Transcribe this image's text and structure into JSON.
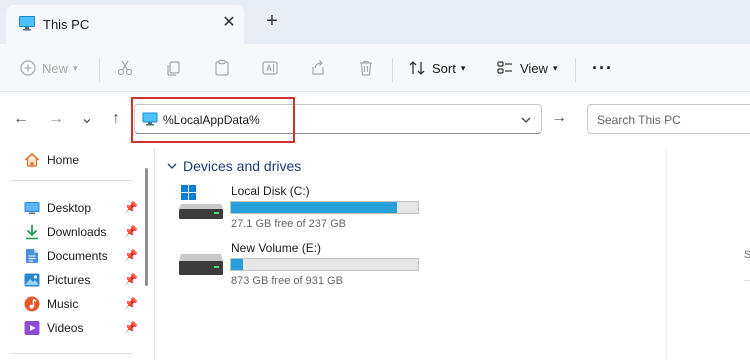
{
  "window": {
    "tab_title": "This PC",
    "tab_close": "✕",
    "new_tab": "+"
  },
  "toolbar": {
    "new_label": "New",
    "sort_label": "Sort",
    "view_label": "View",
    "more_label": "···",
    "disabled_actions": [
      "cut",
      "copy",
      "paste",
      "rename",
      "share",
      "delete"
    ]
  },
  "nav": {
    "back": "←",
    "forward": "→",
    "recent": "⌄",
    "up": "↑",
    "go": "→"
  },
  "address": {
    "value": "%LocalAppData%",
    "highlight_color": "#d0312d"
  },
  "search": {
    "placeholder": "Search This PC"
  },
  "sidebar": {
    "home": "Home",
    "items": [
      {
        "label": "Desktop",
        "icon": "desktop-icon",
        "pinned": true
      },
      {
        "label": "Downloads",
        "icon": "download-icon",
        "pinned": true
      },
      {
        "label": "Documents",
        "icon": "documents-icon",
        "pinned": true
      },
      {
        "label": "Pictures",
        "icon": "pictures-icon",
        "pinned": true
      },
      {
        "label": "Music",
        "icon": "music-icon",
        "pinned": true
      },
      {
        "label": "Videos",
        "icon": "videos-icon",
        "pinned": true
      }
    ]
  },
  "content": {
    "group_title": "Devices and drives",
    "drives": [
      {
        "name": "Local Disk (C:)",
        "free_text": "27.1 GB free of 237 GB",
        "used_fraction": 0.886
      },
      {
        "name": "New Volume (E:)",
        "free_text": "873 GB free of 931 GB",
        "used_fraction": 0.062
      }
    ]
  },
  "details_pane": {
    "letter": "S"
  },
  "colors": {
    "accent": "#0067c0",
    "drive_bar": "#26a0da",
    "titlebar_bg": "#e9eef6"
  }
}
